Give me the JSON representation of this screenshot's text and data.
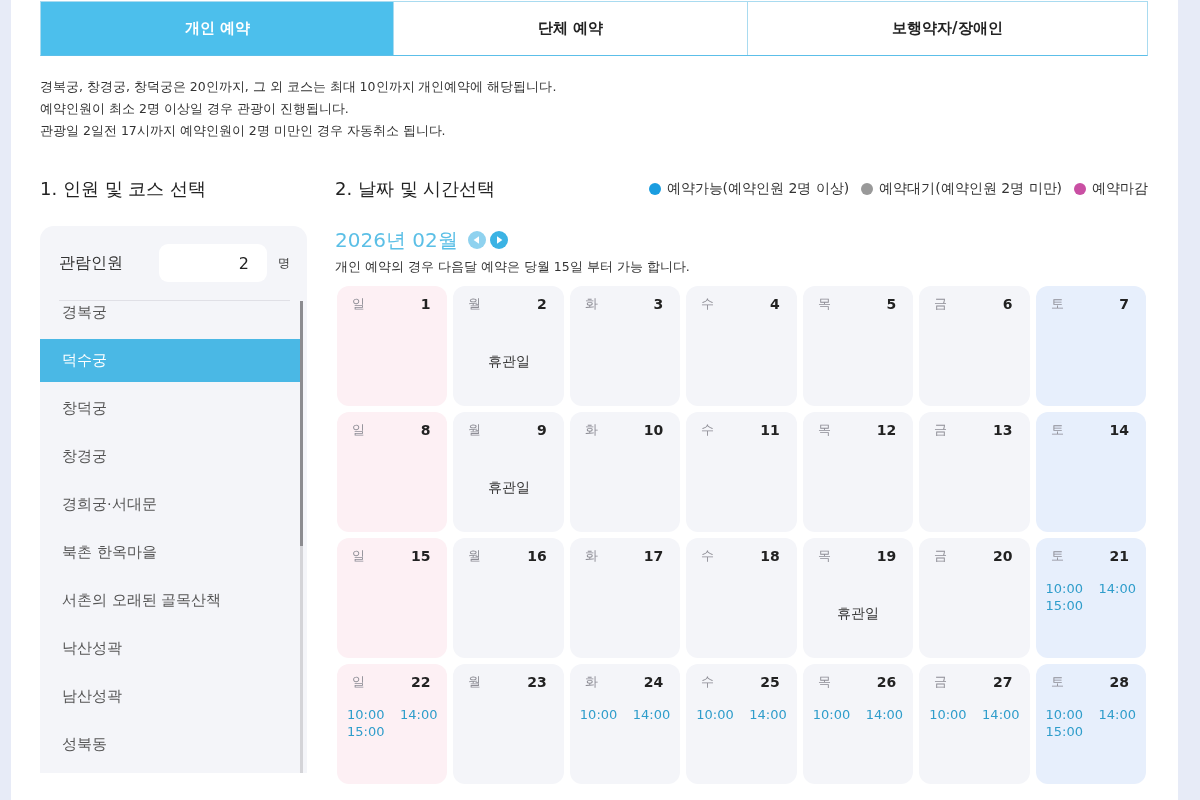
{
  "tabs": [
    {
      "label": "개인 예약",
      "selected": true
    },
    {
      "label": "단체 예약",
      "selected": false
    },
    {
      "label": "보행약자/장애인",
      "selected": false
    }
  ],
  "notes": [
    "경복궁, 창경궁, 창덕궁은 20인까지, 그 외 코스는 최대 10인까지 개인예약에 해당됩니다.",
    "예약인원이 최소 2명 이상일 경우 관광이 진행됩니다.",
    "관광일 2일전 17시까지 예약인원이 2명 미만인 경우 자동취소 됩니다."
  ],
  "course_section": {
    "heading": "1. 인원 및 코스 선택",
    "visitors": {
      "label": "관람인원",
      "value": "2",
      "unit": "명"
    },
    "courses": [
      {
        "label": "경복궁",
        "selected": false
      },
      {
        "label": "덕수궁",
        "selected": true
      },
      {
        "label": "창덕궁",
        "selected": false
      },
      {
        "label": "창경궁",
        "selected": false
      },
      {
        "label": "경희궁·서대문",
        "selected": false
      },
      {
        "label": "북촌 한옥마을",
        "selected": false
      },
      {
        "label": "서촌의 오래된 골목산책",
        "selected": false
      },
      {
        "label": "낙산성곽",
        "selected": false
      },
      {
        "label": "남산성곽",
        "selected": false
      },
      {
        "label": "성북동",
        "selected": false
      }
    ]
  },
  "date_section": {
    "heading": "2. 날짜 및 시간선택",
    "legend": [
      {
        "label": "예약가능(예약인원 2명 이상)",
        "color": "#1a9de0"
      },
      {
        "label": "예약대기(예약인원 2명 미만)",
        "color": "#999999"
      },
      {
        "label": "예약마감",
        "color": "#c94fa3"
      }
    ],
    "calendar": {
      "month": "2026년 02월",
      "nav": [
        {
          "kind": "prev",
          "disabled": true
        },
        {
          "kind": "next",
          "disabled": false
        }
      ],
      "note": "개인 예약의 경우 다음달 예약은 당월 15일 부터 가능 합니다.",
      "weeks": [
        {
          "days": [
            {
              "weekday": "일",
              "date": "1",
              "kind": "sunday"
            },
            {
              "weekday": "월",
              "date": "2",
              "kind": "weekday",
              "note": "휴관일"
            },
            {
              "weekday": "화",
              "date": "3",
              "kind": "weekday"
            },
            {
              "weekday": "수",
              "date": "4",
              "kind": "weekday"
            },
            {
              "weekday": "목",
              "date": "5",
              "kind": "weekday"
            },
            {
              "weekday": "금",
              "date": "6",
              "kind": "weekday"
            },
            {
              "weekday": "토",
              "date": "7",
              "kind": "saturday"
            }
          ]
        },
        {
          "days": [
            {
              "weekday": "일",
              "date": "8",
              "kind": "sunday"
            },
            {
              "weekday": "월",
              "date": "9",
              "kind": "weekday",
              "note": "휴관일"
            },
            {
              "weekday": "화",
              "date": "10",
              "kind": "weekday"
            },
            {
              "weekday": "수",
              "date": "11",
              "kind": "weekday"
            },
            {
              "weekday": "목",
              "date": "12",
              "kind": "weekday"
            },
            {
              "weekday": "금",
              "date": "13",
              "kind": "weekday"
            },
            {
              "weekday": "토",
              "date": "14",
              "kind": "saturday"
            }
          ]
        },
        {
          "days": [
            {
              "weekday": "일",
              "date": "15",
              "kind": "sunday"
            },
            {
              "weekday": "월",
              "date": "16",
              "kind": "weekday"
            },
            {
              "weekday": "화",
              "date": "17",
              "kind": "weekday"
            },
            {
              "weekday": "수",
              "date": "18",
              "kind": "weekday"
            },
            {
              "weekday": "목",
              "date": "19",
              "kind": "weekday",
              "note": "휴관일"
            },
            {
              "weekday": "금",
              "date": "20",
              "kind": "weekday"
            },
            {
              "weekday": "토",
              "date": "21",
              "kind": "saturday",
              "slots": [
                {
                  "time": "10:00",
                  "available": true
                },
                {
                  "time": "14:00",
                  "available": true
                },
                {
                  "time": "15:00",
                  "available": true
                }
              ]
            }
          ]
        },
        {
          "days": [
            {
              "weekday": "일",
              "date": "22",
              "kind": "sunday",
              "slots": [
                {
                  "time": "10:00",
                  "available": true
                },
                {
                  "time": "14:00",
                  "available": true
                },
                {
                  "time": "15:00",
                  "available": true
                }
              ]
            },
            {
              "weekday": "월",
              "date": "23",
              "kind": "weekday"
            },
            {
              "weekday": "화",
              "date": "24",
              "kind": "weekday",
              "slots": [
                {
                  "time": "10:00",
                  "available": true
                },
                {
                  "time": "14:00",
                  "available": true
                }
              ]
            },
            {
              "weekday": "수",
              "date": "25",
              "kind": "weekday",
              "slots": [
                {
                  "time": "10:00",
                  "available": true
                },
                {
                  "time": "14:00",
                  "available": true
                }
              ]
            },
            {
              "weekday": "목",
              "date": "26",
              "kind": "weekday",
              "slots": [
                {
                  "time": "10:00",
                  "available": true
                },
                {
                  "time": "14:00",
                  "available": true
                }
              ]
            },
            {
              "weekday": "금",
              "date": "27",
              "kind": "weekday",
              "slots": [
                {
                  "time": "10:00",
                  "available": true
                },
                {
                  "time": "14:00",
                  "available": true
                }
              ]
            },
            {
              "weekday": "토",
              "date": "28",
              "kind": "saturday",
              "slots": [
                {
                  "time": "10:00",
                  "available": true
                },
                {
                  "time": "14:00",
                  "available": true
                },
                {
                  "time": "15:00",
                  "available": true
                }
              ]
            }
          ]
        }
      ]
    }
  }
}
